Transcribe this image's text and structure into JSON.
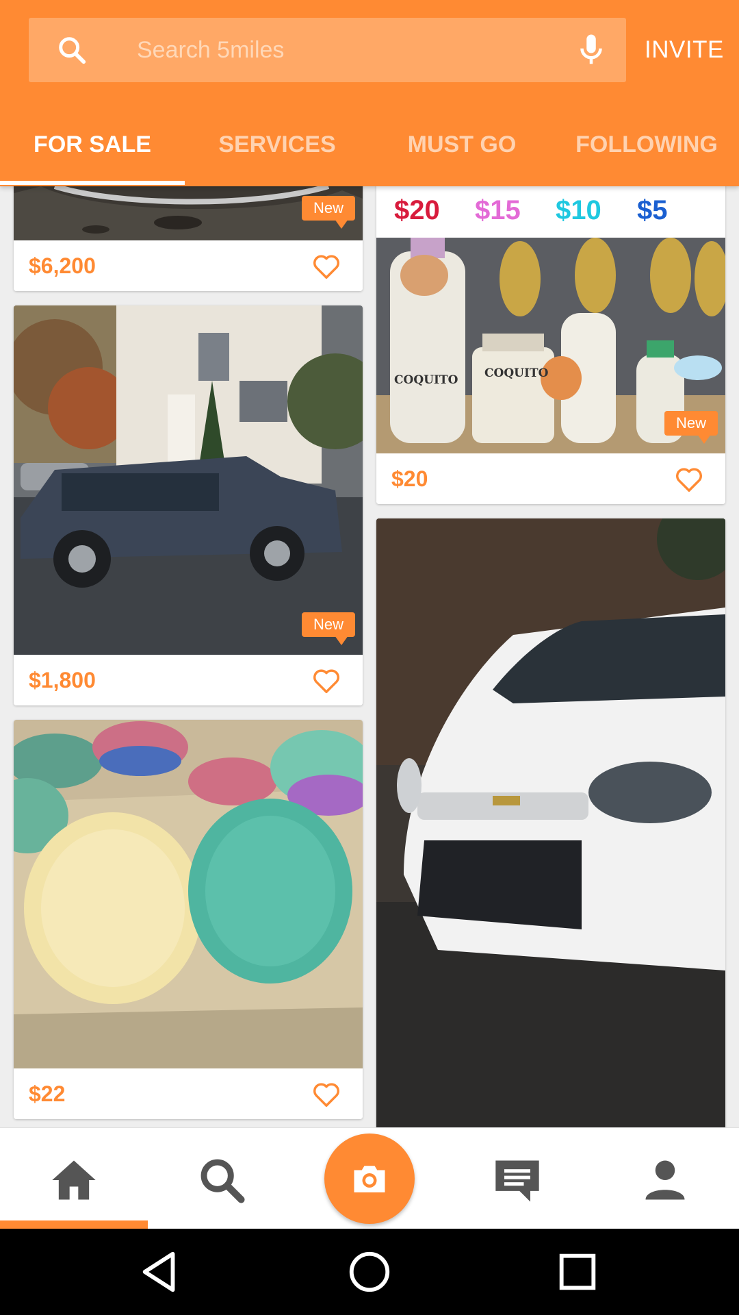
{
  "search": {
    "placeholder": "Search 5miles",
    "icon": "search-icon",
    "voice_icon": "mic-icon"
  },
  "header": {
    "invite_label": "INVITE"
  },
  "tabs": [
    {
      "label": "FOR SALE",
      "active": true
    },
    {
      "label": "SERVICES",
      "active": false
    },
    {
      "label": "MUST GO",
      "active": false
    },
    {
      "label": "FOLLOWING",
      "active": false
    }
  ],
  "colors": {
    "brand": "#ff8a33",
    "price": "#ff8a33"
  },
  "listings": [
    {
      "price": "$6,200",
      "badge": "New",
      "image": "car-partial-photo"
    },
    {
      "price": "$1,800",
      "badge": "New",
      "image": "blue-suv-photo"
    },
    {
      "price": "$22",
      "badge": "",
      "image": "colorful-plates-photo"
    },
    {
      "price": "$20",
      "badge": "New",
      "image": "coquito-bottles-photo",
      "flyer_prices": [
        {
          "text": "$20",
          "color": "#d81b3c"
        },
        {
          "text": "$15",
          "color": "#e36ad6"
        },
        {
          "text": "$10",
          "color": "#1fc8e0"
        },
        {
          "text": "$5",
          "color": "#1a5fd1"
        }
      ],
      "bottle_labels": [
        "COQUITO",
        "COQUITO"
      ]
    },
    {
      "price": "",
      "badge": "",
      "image": "white-sedan-photo"
    }
  ],
  "bottom_nav": [
    {
      "name": "home",
      "icon": "home-icon",
      "active": true
    },
    {
      "name": "search",
      "icon": "search-icon",
      "active": false
    },
    {
      "name": "sell",
      "icon": "camera-icon",
      "active": false
    },
    {
      "name": "messages",
      "icon": "chat-icon",
      "active": false
    },
    {
      "name": "profile",
      "icon": "person-icon",
      "active": false
    }
  ],
  "system_bar": [
    "back-icon",
    "home-circle-icon",
    "recents-icon"
  ]
}
